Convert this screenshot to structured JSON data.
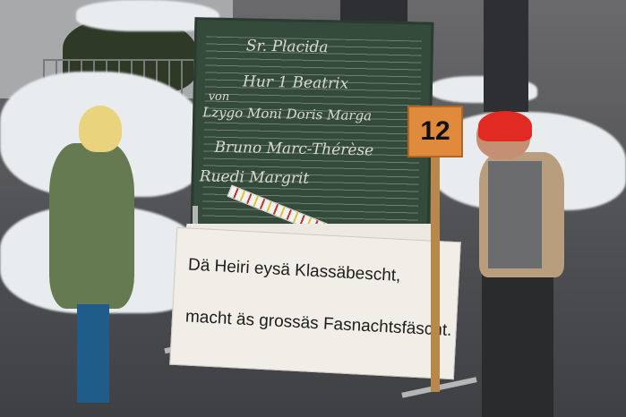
{
  "chalkboard": {
    "lines": [
      "Sr. Placida",
      "Hur 1   Beatrix",
      "von",
      "Lzygo Moni  Doris  Marga",
      "Bruno  Marc-Thérèse",
      "Ruedi        Margrit"
    ]
  },
  "number_card": "12",
  "sign": {
    "line1": "Dä Heiri eysä Klassäbescht,",
    "line2": "macht äs grossäs Fasnachtsfäscht."
  },
  "colors": {
    "chalkboard": "#344b3c",
    "number_card": "#e08a3c",
    "cap": "#e02a22",
    "snow": "#e8ecef"
  }
}
